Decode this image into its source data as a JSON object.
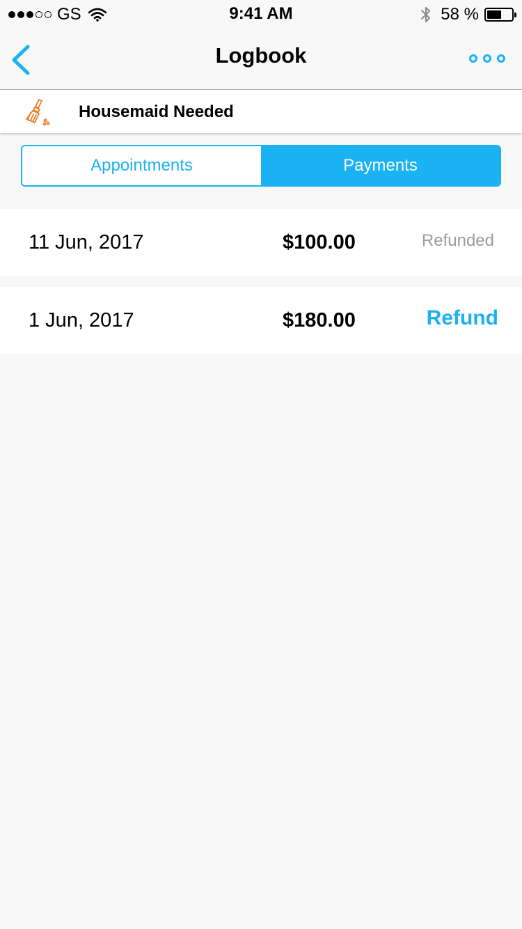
{
  "status_bar": {
    "carrier": "GS",
    "time": "9:41 AM",
    "battery_percent": "58 %",
    "battery_level": 0.58,
    "signal_bars_filled": 3,
    "signal_bars_total": 5
  },
  "nav": {
    "title": "Logbook",
    "back_icon": "chevron-left-icon",
    "more_icon": "more-dots-icon"
  },
  "job": {
    "icon": "broom-icon",
    "title": "Housemaid Needed"
  },
  "tabs": [
    {
      "label": "Appointments",
      "selected": false
    },
    {
      "label": "Payments",
      "selected": true
    }
  ],
  "payments": [
    {
      "date": "11 Jun, 2017",
      "amount": "$100.00",
      "status": "Refunded"
    },
    {
      "date": "1 Jun, 2017",
      "amount": "$180.00",
      "action": "Refund"
    }
  ],
  "colors": {
    "accent": "#1ab2f2",
    "broom": "#f07a27",
    "muted_text": "#9b9b9b",
    "background": "#f8f8f8"
  }
}
